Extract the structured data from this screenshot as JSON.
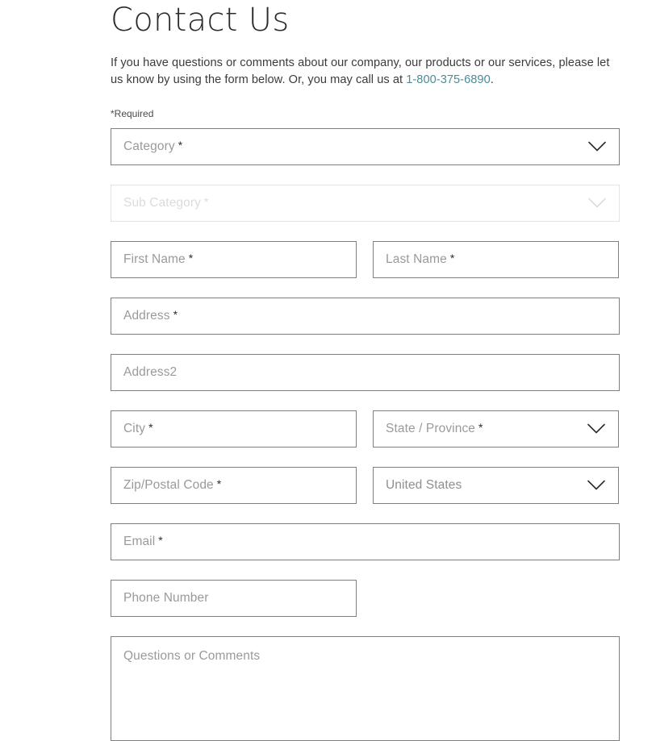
{
  "page": {
    "title": "Contact Us",
    "intro_before_link": "If you have questions or comments about our company, our products or our services, please let us know by using the form below. Or, you may call us at ",
    "phone_link": "1-800-375-6890",
    "intro_after_link": ".",
    "required_note": "*Required",
    "link_color": "#4b8c97",
    "required_star": "*"
  },
  "form": {
    "category": {
      "placeholder": "Category",
      "required": "*",
      "icon": "chevron-down-icon"
    },
    "sub_category": {
      "placeholder": "Sub Category",
      "required": "*",
      "icon": "chevron-down-icon",
      "state": "disabled"
    },
    "first_name": {
      "placeholder": "First Name",
      "required": "*"
    },
    "last_name": {
      "placeholder": "Last Name",
      "required": "*"
    },
    "address": {
      "placeholder": "Address",
      "required": "*"
    },
    "address2": {
      "placeholder": "Address2",
      "required": ""
    },
    "city": {
      "placeholder": "City",
      "required": "*"
    },
    "state_province": {
      "placeholder": "State / Province",
      "required": "*",
      "icon": "chevron-down-icon"
    },
    "zip_postal": {
      "placeholder": "Zip/Postal Code",
      "required": "*"
    },
    "country": {
      "value": "United States",
      "icon": "chevron-down-icon"
    },
    "email": {
      "placeholder": "Email",
      "required": "*"
    },
    "phone_number": {
      "placeholder": "Phone Number",
      "required": ""
    },
    "questions_comments": {
      "placeholder": "Questions or Comments",
      "required": ""
    }
  }
}
